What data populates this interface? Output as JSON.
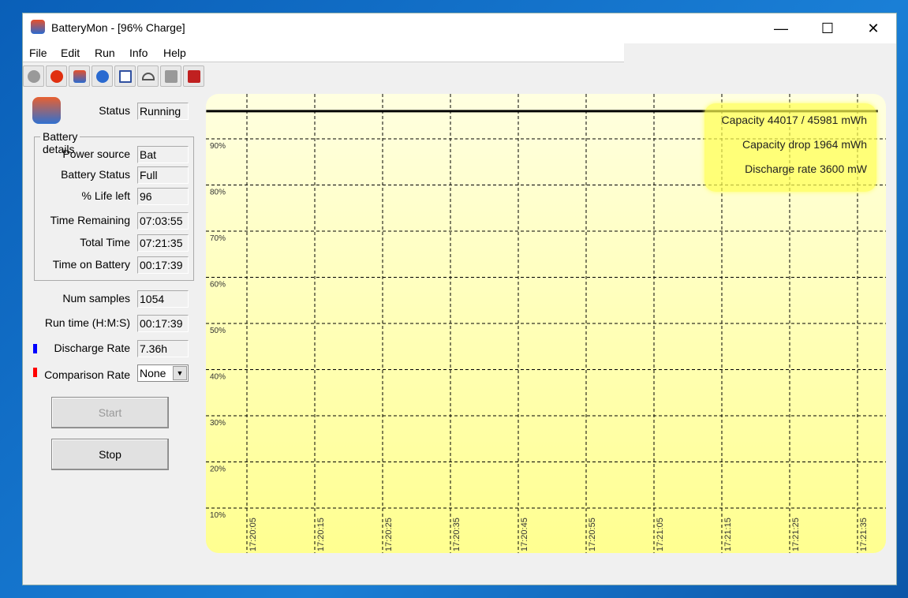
{
  "window": {
    "title": "BatteryMon - [96% Charge]",
    "minimize": "—",
    "maximize": "☐",
    "close": "✕"
  },
  "menu": [
    "File",
    "Edit",
    "Run",
    "Info",
    "Help"
  ],
  "toolbar": [
    "record-icon",
    "stop-icon",
    "battery-icon",
    "settings-icon",
    "checklist-icon",
    "gauge-icon",
    "plug-icon",
    "battery-info-icon"
  ],
  "status": {
    "label": "Status",
    "value": "Running"
  },
  "battery_details": {
    "title": "Battery details",
    "rows": [
      {
        "label": "Power source",
        "value": "Bat"
      },
      {
        "label": "Battery Status",
        "value": "Full"
      },
      {
        "label": "% Life left",
        "value": "96"
      },
      {
        "label": "Time Remaining",
        "value": "07:03:55"
      },
      {
        "label": "Total Time",
        "value": "07:21:35"
      },
      {
        "label": "Time on Battery",
        "value": "00:17:39"
      }
    ]
  },
  "stats": [
    {
      "label": "Num samples",
      "value": "1054"
    },
    {
      "label": "Run time (H:M:S)",
      "value": "00:17:39"
    },
    {
      "label": "Discharge Rate",
      "value": "7.36h",
      "marker": "#0000ff"
    }
  ],
  "comparison": {
    "label": "Comparison Rate",
    "value": "None",
    "marker": "#ff0000"
  },
  "buttons": {
    "start": "Start",
    "stop": "Stop"
  },
  "info": {
    "capacity": "Capacity 44017 / 45981 mWh",
    "drop": "Capacity drop 1964 mWh",
    "rate": "Discharge rate 3600 mW"
  },
  "chart_data": {
    "type": "line",
    "ylim": [
      0,
      100
    ],
    "yticks": [
      "90%",
      "80%",
      "70%",
      "60%",
      "50%",
      "40%",
      "30%",
      "20%",
      "10%"
    ],
    "xticks": [
      "17:20:05",
      "17:20:15",
      "17:20:25",
      "17:20:35",
      "17:20:45",
      "17:20:55",
      "17:21:05",
      "17:21:15",
      "17:21:25",
      "17:21:35"
    ],
    "grid": true,
    "series": [
      {
        "color": "#000000",
        "points": [
          {
            "t": "17:19:59",
            "y": 96
          },
          {
            "t": "17:21:38",
            "y": 96
          }
        ]
      }
    ]
  }
}
